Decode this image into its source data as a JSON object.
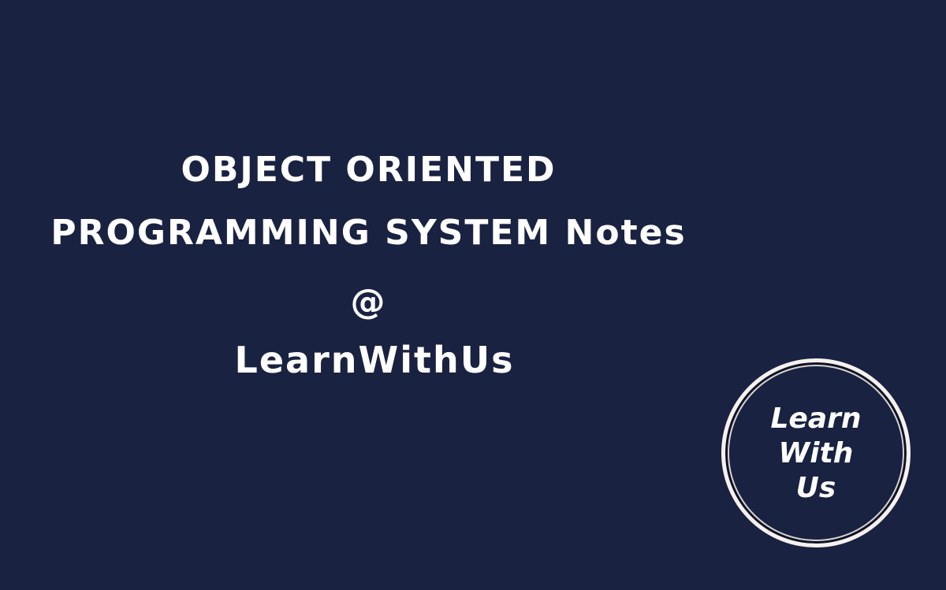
{
  "title": {
    "line1": "OBJECT ORIENTED",
    "line2": "PROGRAMMING SYSTEM Notes",
    "line3": "@",
    "line4": "LearnWithUs"
  },
  "logo": {
    "lines": [
      "Learn",
      "With",
      "Us"
    ]
  },
  "colors": {
    "background": "#192240",
    "text": "#ffffff"
  }
}
